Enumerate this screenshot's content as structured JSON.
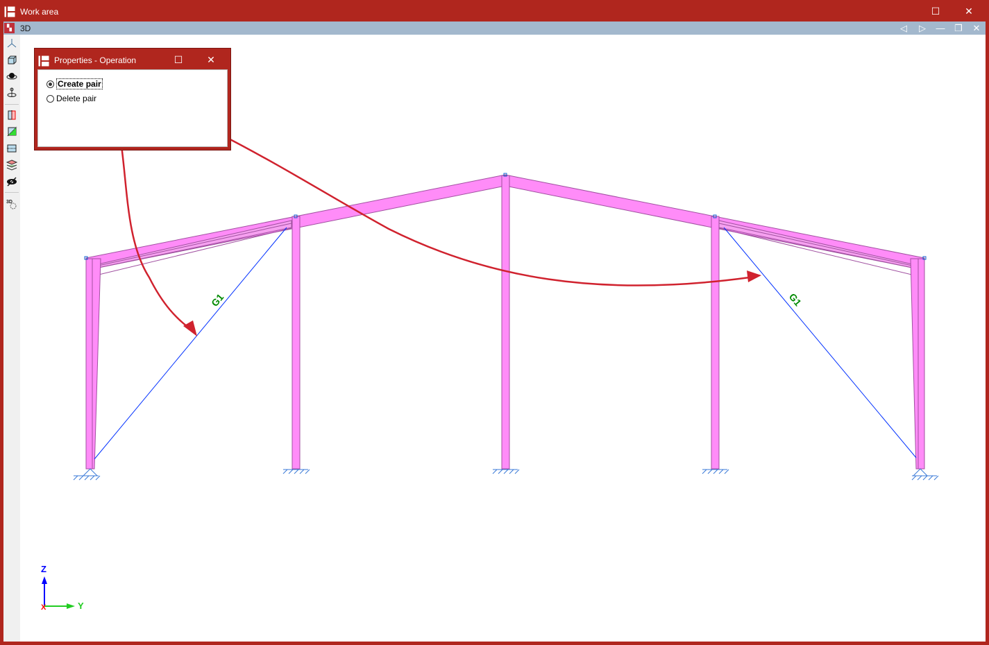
{
  "window": {
    "title": "Work area",
    "maximize_icon": "maximize-icon",
    "close_icon": "close-icon"
  },
  "view": {
    "title": "3D",
    "buttons": [
      "prev-icon",
      "next-icon",
      "minimize-icon",
      "restore-icon",
      "close-icon"
    ]
  },
  "toolbar": {
    "icons": [
      "axes-icon",
      "cube-view-icon",
      "orbit-icon",
      "rotate-axis-icon",
      "section-red-icon",
      "section-green-icon",
      "section-blue-icon",
      "layers-icon",
      "hide-icon",
      "3d-settings-icon"
    ]
  },
  "dialog": {
    "title": "Properties - Operation",
    "options": [
      {
        "label": "Create pair",
        "selected": true
      },
      {
        "label": "Delete pair",
        "selected": false
      }
    ]
  },
  "model": {
    "brace_labels": [
      "G1",
      "G1"
    ],
    "colors": {
      "member": "#ff8cf8",
      "member_edge": "#a050a0",
      "brace": "#0030ff",
      "label": "#008a00",
      "annotation_arrow": "#d0222e"
    }
  },
  "axes": {
    "z": "Z",
    "y": "Y",
    "x": "X"
  }
}
